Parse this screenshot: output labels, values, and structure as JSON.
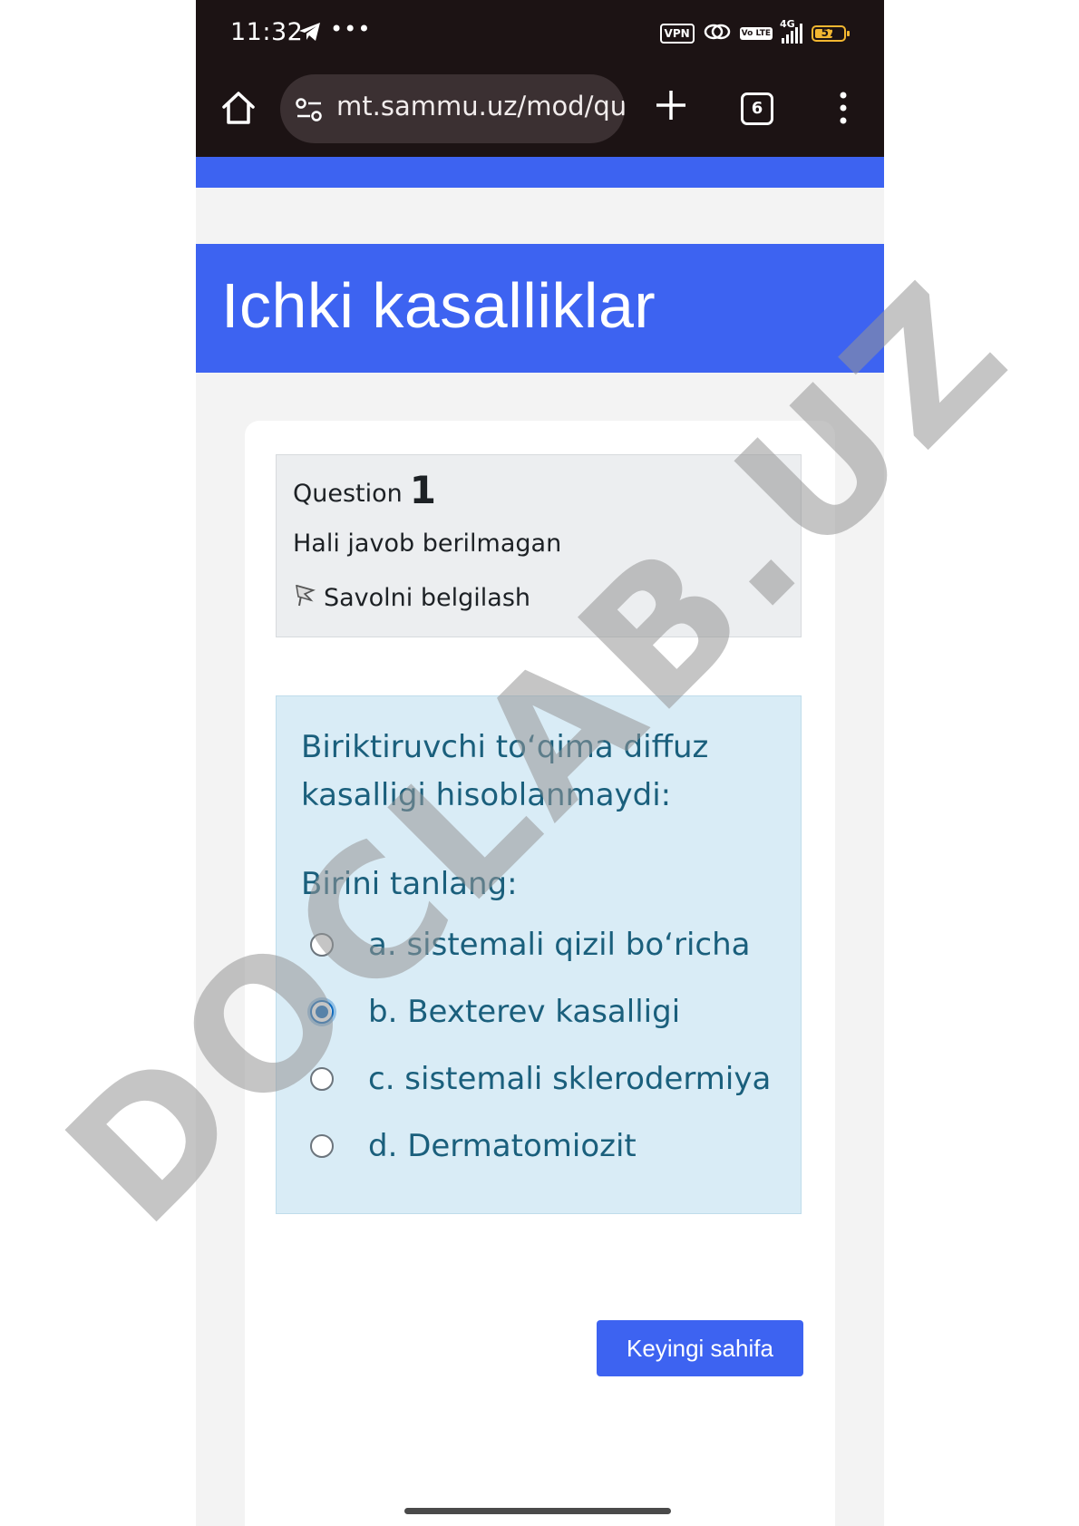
{
  "status_bar": {
    "time": "11:32",
    "vpn": "VPN",
    "network": "4G",
    "volte": "Vo LTE",
    "battery": "57",
    "more": "•••"
  },
  "browser": {
    "url": "mt.sammu.uz/mod/qu",
    "tab_count": "6"
  },
  "page": {
    "course_title": "Ichki kasalliklar"
  },
  "question_info": {
    "label": "Question",
    "number": "1",
    "state": "Hali javob berilmagan",
    "flag_label": "Savolni belgilash"
  },
  "question": {
    "text": "Biriktiruvchi toʻqima diffuz kasalligi hisoblanmaydi:",
    "prompt": "Birini tanlang:",
    "answers": [
      {
        "label": "a. sistemali qizil boʻricha",
        "selected": false
      },
      {
        "label": "b. Bexterev kasalligi",
        "selected": true
      },
      {
        "label": "c. sistemali sklerodermiya",
        "selected": false
      },
      {
        "label": "d. Dermatomiozit",
        "selected": false
      }
    ]
  },
  "navigation": {
    "next_label": "Keyingi sahifa"
  },
  "watermark": "DOCLAB.UZ",
  "colors": {
    "brand_blue": "#3d63f1",
    "question_bg": "#d9ecf6",
    "question_text": "#1a5f7c",
    "chrome_bg": "#1c1314"
  }
}
